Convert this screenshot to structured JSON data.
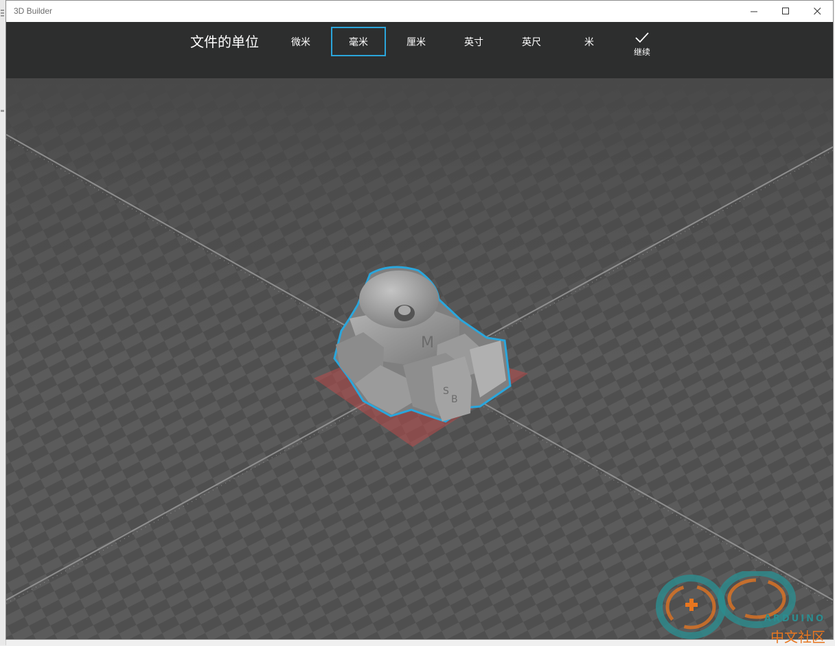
{
  "window": {
    "title": "3D Builder"
  },
  "window_controls": {
    "minimize_icon": "minimize-icon",
    "maximize_icon": "maximize-icon",
    "close_icon": "close-icon"
  },
  "units_bar": {
    "heading": "文件的单位",
    "options": [
      {
        "label": "微米",
        "selected": false
      },
      {
        "label": "毫米",
        "selected": true
      },
      {
        "label": "厘米",
        "selected": false
      },
      {
        "label": "英寸",
        "selected": false
      },
      {
        "label": "英尺",
        "selected": false
      },
      {
        "label": "米",
        "selected": false
      }
    ],
    "continue_label": "继续",
    "continue_icon": "checkmark-icon",
    "accent_color": "#2aa6dc"
  },
  "viewport": {
    "model_letters": [
      "M",
      "S",
      "B"
    ],
    "selection_color": "#2aa6dc",
    "footprint_color": "#b94a4a",
    "grid_colors": [
      "#4c4c4c",
      "#5a5a5a"
    ]
  },
  "watermark": {
    "sub": "ARDUINO",
    "main": "中文社区"
  }
}
